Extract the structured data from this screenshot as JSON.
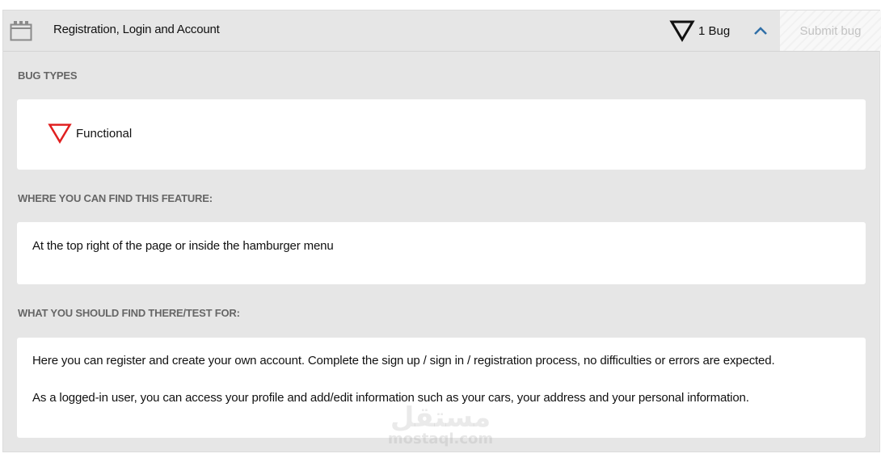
{
  "header": {
    "title": "Registration, Login and Account",
    "feature_icon": "calendar-icon",
    "bug_icon": "triangle-down-icon",
    "bug_count_label": "1 Bug",
    "collapse_icon": "chevron-up-icon",
    "submit_label": "Submit bug"
  },
  "sections": {
    "bug_types": {
      "title": "BUG TYPES",
      "items": [
        {
          "label": "Functional",
          "icon": "triangle-down-icon",
          "color": "#e02020"
        }
      ]
    },
    "location": {
      "title": "WHERE YOU CAN FIND THIS FEATURE:",
      "text": "At the top right of the page or inside the hamburger menu"
    },
    "test_for": {
      "title": "WHAT YOU SHOULD FIND THERE/TEST FOR:",
      "paragraphs": [
        "Here you can register and create your own account. Complete the sign up / sign in / registration process, no difficulties or errors are expected.",
        "As a logged-in user, you can access your profile and add/edit information such as your cars, your address and your personal information."
      ]
    }
  },
  "watermark": {
    "arabic": "مستقل",
    "latin": "mostaql.com"
  },
  "colors": {
    "panel_bg": "#e6e6e6",
    "card_bg": "#ffffff",
    "section_label": "#666666",
    "chevron": "#2f6fa7",
    "functional_bug": "#e02020",
    "submit_disabled_text": "#c2c2c2"
  }
}
